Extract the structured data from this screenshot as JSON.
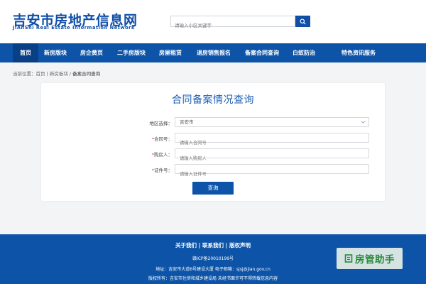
{
  "header": {
    "logo_cn": "吉安市房地产信息网",
    "logo_en": "JiAnShi Real Estate Information Network",
    "search_placeholder": "请输入小区关键字"
  },
  "nav": {
    "items": [
      "首页",
      "新房版块",
      "房企黄页",
      "二手房版块",
      "房屋租赁",
      "退房销售报名",
      "备案合同查询",
      "白蚁防治",
      "特色资讯服务"
    ],
    "active": "首页"
  },
  "breadcrumb": {
    "prefix": "当前位置：",
    "home": "首页",
    "section": "新房板块",
    "current": "备案合同查询"
  },
  "form": {
    "title": "合同备案情况查询",
    "region_label": "地区选择：",
    "region_value": "吉安市",
    "contract_label": "合同号：",
    "contract_placeholder": "请输入合同号",
    "buyer_label": "购房人：",
    "buyer_placeholder": "请输入购房人",
    "id_label": "证件号：",
    "id_placeholder": "请输入证件号",
    "required_mark": "*",
    "submit_label": "查询"
  },
  "footer": {
    "links": [
      "关于我们",
      "联系我们",
      "版权声明"
    ],
    "separator": " | ",
    "icp": "赣ICP备20010199号",
    "address": "地址：吉安市大道6号建设大厦 电子邮箱：sjsj@jian.gov.cn",
    "copyright": "版权所有：吉安市住房和城乡建设局 未经书面许可不得转载信息内容"
  },
  "watermark": {
    "text": "房管助手"
  },
  "colors": {
    "brand_blue": "#0d54a8",
    "active_nav": "#0a3f86",
    "required_red": "#e03a3a",
    "badge_green": "#2a8a3a"
  }
}
